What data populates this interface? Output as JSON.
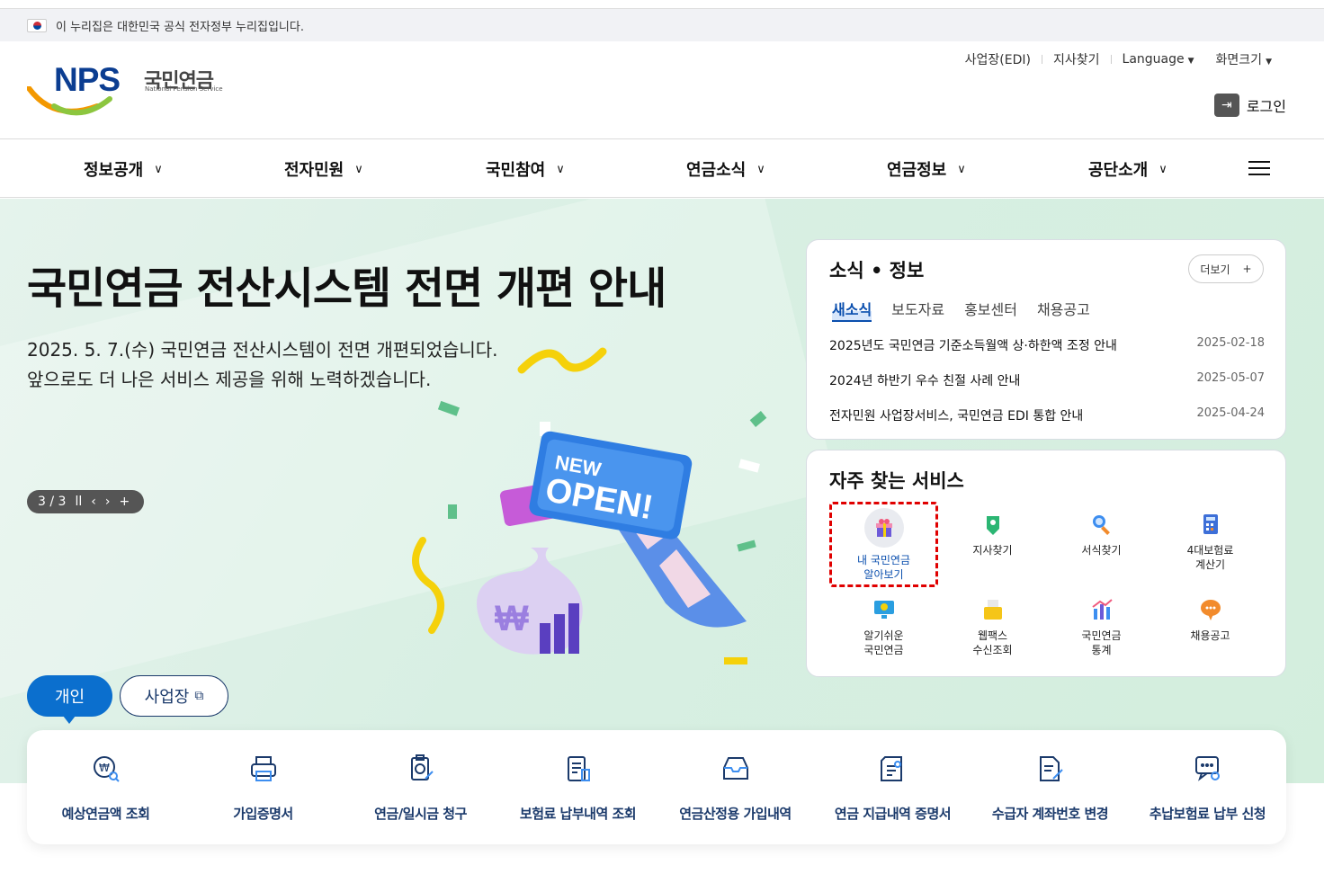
{
  "gov_banner": {
    "text": "이 누리집은 대한민국 공식 전자정부 누리집입니다."
  },
  "logo": {
    "brand": "NPS",
    "name_ko": "국민연금",
    "name_en": "National Pension Service"
  },
  "utility": {
    "items": [
      "사업장(EDI)",
      "지사찾기",
      "Language",
      "화면크기"
    ],
    "login": "로그인"
  },
  "gnb": {
    "menus": [
      "정보공개",
      "전자민원",
      "국민참여",
      "연금소식",
      "연금정보",
      "공단소개"
    ]
  },
  "hero": {
    "title": "국민연금 전산시스템 전면 개편 안내",
    "desc_line1": "2025. 5. 7.(수) 국민연금 전산시스템이 전면 개편되었습니다.",
    "desc_line2": "앞으로도 더 나은 서비스 제공을 위해 노력하겠습니다.",
    "slide_counter": "3 / 3",
    "badge_top": "NEW",
    "badge_bottom": "OPEN!"
  },
  "news": {
    "title": "소식 • 정보",
    "more": "더보기",
    "tabs": [
      "새소식",
      "보도자료",
      "홍보센터",
      "채용공고"
    ],
    "active_tab": "새소식",
    "items": [
      {
        "title": "2025년도 국민연금 기준소득월액 상·하한액 조정 안내",
        "date": "2025-02-18"
      },
      {
        "title": "2024년 하반기 우수 친절 사례 안내",
        "date": "2025-05-07"
      },
      {
        "title": "전자민원 사업장서비스, 국민연금 EDI 통합 안내",
        "date": "2025-04-24"
      }
    ]
  },
  "services": {
    "title": "자주 찾는 서비스",
    "items": [
      {
        "l1": "내 국민연금",
        "l2": "알아보기",
        "icon": "gift-icon",
        "highlighted": true
      },
      {
        "l1": "지사찾기",
        "l2": "",
        "icon": "location-icon"
      },
      {
        "l1": "서식찾기",
        "l2": "",
        "icon": "search-icon"
      },
      {
        "l1": "4대보험료",
        "l2": "계산기",
        "icon": "calculator-icon"
      },
      {
        "l1": "알기쉬운",
        "l2": "국민연금",
        "icon": "monitor-icon"
      },
      {
        "l1": "웹팩스",
        "l2": "수신조회",
        "icon": "fax-icon"
      },
      {
        "l1": "국민연금",
        "l2": "통계",
        "icon": "chart-icon"
      },
      {
        "l1": "채용공고",
        "l2": "",
        "icon": "chat-icon"
      }
    ]
  },
  "user_tabs": {
    "personal": "개인",
    "business": "사업장"
  },
  "quick_menu": [
    {
      "label": "예상연금액 조회",
      "icon": "coin-search-icon"
    },
    {
      "label": "가입증명서",
      "icon": "printer-icon"
    },
    {
      "label": "연금/일시금 청구",
      "icon": "clipboard-coin-icon"
    },
    {
      "label": "보험료 납부내역 조회",
      "icon": "document-list-icon"
    },
    {
      "label": "연금산정용 가입내역",
      "icon": "inbox-icon"
    },
    {
      "label": "연금 지급내역 증명서",
      "icon": "certificate-icon"
    },
    {
      "label": "수급자 계좌번호 변경",
      "icon": "edit-document-icon"
    },
    {
      "label": "추납보험료 납부 신청",
      "icon": "chat-search-icon"
    }
  ],
  "colors": {
    "primary": "#0b6fce",
    "navy": "#1b3a6b",
    "hero_bg": "#d8efe3",
    "highlight": "#e00000"
  }
}
